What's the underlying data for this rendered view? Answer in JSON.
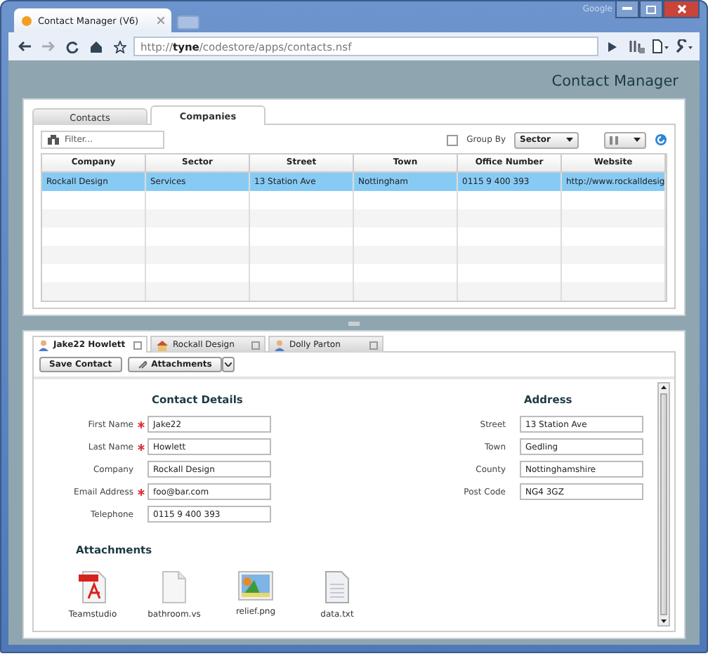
{
  "browser": {
    "tab_title": "Contact Manager (V6)",
    "url_prefix": "http://",
    "url_host": "tyne",
    "url_path": "/codestore/apps/contacts.nsf",
    "brand": "Google"
  },
  "app": {
    "title": "Contact Manager"
  },
  "top_tabs": [
    {
      "label": "Contacts",
      "selected": false
    },
    {
      "label": "Companies",
      "selected": true
    }
  ],
  "filter": {
    "placeholder": "Filter..."
  },
  "group_by": {
    "label": "Group By",
    "checked": false,
    "value": "Sector"
  },
  "table": {
    "columns": [
      "Company",
      "Sector",
      "Street",
      "Town",
      "Office Number",
      "Website"
    ],
    "rows": [
      {
        "cells": [
          "Rockall Design",
          "Services",
          "13 Station Ave",
          "Nottingham",
          "0115 9 400 393",
          "http://www.rockalldesig"
        ],
        "selected": true
      }
    ]
  },
  "doc_tabs": [
    {
      "label": "Jake22 Howlett",
      "kind": "person",
      "selected": true
    },
    {
      "label": "Rockall Design",
      "kind": "company",
      "selected": false
    },
    {
      "label": "Dolly Parton",
      "kind": "person",
      "selected": false
    }
  ],
  "toolbar": {
    "save": "Save Contact",
    "attachments": "Attachments"
  },
  "contact_details": {
    "title": "Contact Details",
    "fields": [
      {
        "label": "First Name",
        "value": "Jake22",
        "required": true
      },
      {
        "label": "Last Name",
        "value": "Howlett",
        "required": true
      },
      {
        "label": "Company",
        "value": "Rockall Design",
        "required": false
      },
      {
        "label": "Email Address",
        "value": "foo@bar.com",
        "required": true
      },
      {
        "label": "Telephone",
        "value": "0115 9 400 393",
        "required": false
      }
    ]
  },
  "address": {
    "title": "Address",
    "fields": [
      {
        "label": "Street",
        "value": "13 Station Ave",
        "required": false
      },
      {
        "label": "Town",
        "value": "Gedling",
        "required": false
      },
      {
        "label": "County",
        "value": "Nottinghamshire",
        "required": false
      },
      {
        "label": "Post Code",
        "value": "NG4 3GZ",
        "required": false
      }
    ]
  },
  "attachments": {
    "title": "Attachments",
    "files": [
      {
        "name": "Teamstudio",
        "kind": "pdf"
      },
      {
        "name": "bathroom.vs",
        "kind": "blank"
      },
      {
        "name": "relief.png",
        "kind": "image"
      },
      {
        "name": "data.txt",
        "kind": "text"
      }
    ]
  }
}
